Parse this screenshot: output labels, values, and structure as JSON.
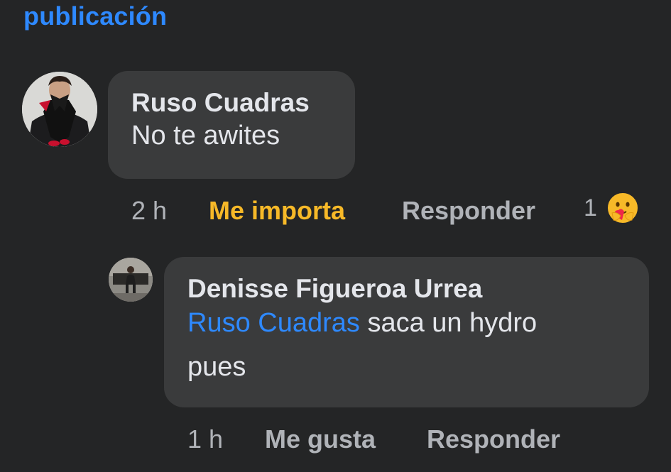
{
  "header": {
    "link_text": "publicación"
  },
  "comments": [
    {
      "author": "Ruso Cuadras",
      "text": "No te awites",
      "time": "2 h",
      "reaction_action": "Me importa",
      "reply_action": "Responder",
      "reaction_count": "1",
      "reaction_icon": "care-emoji-icon",
      "reaction_color": "#f7b928"
    },
    {
      "author": "Denisse Figueroa Urrea",
      "mention": "Ruso Cuadras",
      "text_line1": "saca un hydro",
      "text_line2": "pues",
      "time": "1 h",
      "like_action": "Me gusta",
      "reply_action": "Responder"
    }
  ],
  "colors": {
    "background": "#242526",
    "bubble": "#3a3b3c",
    "link": "#2e89ff",
    "meta": "#b0b3b8"
  }
}
